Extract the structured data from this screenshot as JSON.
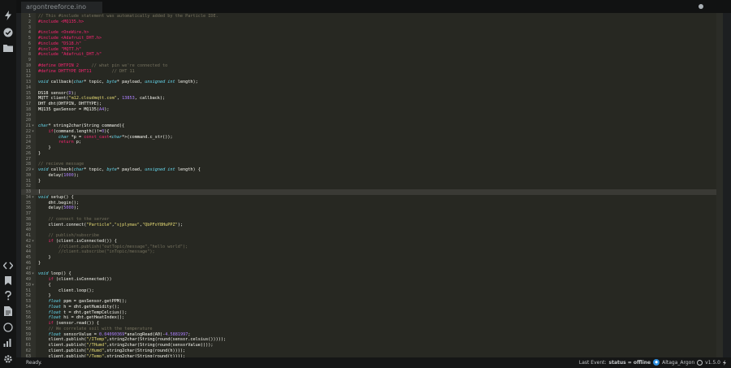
{
  "tab": {
    "filename": "argontreeforce.ino"
  },
  "status": {
    "ready": "Ready.",
    "last_event_label": "Last Event:",
    "last_event_value": "status = offline",
    "device_name": "Altaga_Argon",
    "version": "v1.5.0"
  },
  "sidebar_icons": [
    "flash-icon",
    "verify-icon",
    "folder-icon",
    "code-icon",
    "bookmark-icon",
    "help-icon",
    "document-icon",
    "target-icon",
    "chart-icon",
    "gear-icon"
  ],
  "code_lines": [
    {
      "n": 1,
      "segs": [
        [
          "cm",
          "// This #include statement was automatically added by the Particle IDE."
        ]
      ]
    },
    {
      "n": 2,
      "segs": [
        [
          "pp",
          "#include <MQ135.h>"
        ]
      ]
    },
    {
      "n": 3,
      "segs": []
    },
    {
      "n": 4,
      "segs": [
        [
          "pp",
          "#include <OneWire.h>"
        ]
      ]
    },
    {
      "n": 5,
      "segs": [
        [
          "pp",
          "#include <Adafruit_DHT.h>"
        ]
      ]
    },
    {
      "n": 6,
      "segs": [
        [
          "pp",
          "#include \"DS18.h\""
        ]
      ]
    },
    {
      "n": 7,
      "segs": [
        [
          "pp",
          "#include \"MQTT.h\""
        ]
      ]
    },
    {
      "n": 8,
      "segs": [
        [
          "pp",
          "#include \"Adafruit_DHT.h\""
        ]
      ]
    },
    {
      "n": 9,
      "segs": []
    },
    {
      "n": 10,
      "segs": [
        [
          "pp",
          "#define DHTPIN 2"
        ],
        [
          "cm",
          "     // what pin we're connected to"
        ]
      ]
    },
    {
      "n": 11,
      "segs": [
        [
          "pp",
          "#define DHTTYPE DHT11"
        ],
        [
          "cm",
          "        // DHT 11"
        ]
      ]
    },
    {
      "n": 12,
      "segs": []
    },
    {
      "n": 13,
      "segs": [
        [
          "kw",
          "void"
        ],
        [
          "tx",
          " callback("
        ],
        [
          "kw",
          "char"
        ],
        [
          "tx",
          "* topic, "
        ],
        [
          "kw",
          "byte"
        ],
        [
          "tx",
          "* payload, "
        ],
        [
          "kw",
          "unsigned int"
        ],
        [
          "tx",
          " length);"
        ]
      ]
    },
    {
      "n": 14,
      "segs": []
    },
    {
      "n": 15,
      "segs": [
        [
          "tx",
          "DS18 sensor("
        ],
        [
          "nu",
          "D"
        ],
        [
          "tx",
          ");"
        ]
      ]
    },
    {
      "n": 16,
      "segs": [
        [
          "tx",
          "MQTT client("
        ],
        [
          "st",
          "\"m12.cloudmqtt.com\""
        ],
        [
          "tx",
          ", "
        ],
        [
          "nu",
          "13853"
        ],
        [
          "tx",
          ", callback);"
        ]
      ]
    },
    {
      "n": 17,
      "segs": [
        [
          "tx",
          "DHT dht(DHTPIN, DHTTYPE);"
        ]
      ]
    },
    {
      "n": 18,
      "segs": [
        [
          "tx",
          "MQ135 gasSensor = MQ135("
        ],
        [
          "nu",
          "A4"
        ],
        [
          "tx",
          ");"
        ]
      ]
    },
    {
      "n": 19,
      "segs": []
    },
    {
      "n": 20,
      "segs": []
    },
    {
      "n": 21,
      "fold": true,
      "segs": [
        [
          "kw",
          "char"
        ],
        [
          "tx",
          "* string2char(String command){"
        ]
      ]
    },
    {
      "n": 22,
      "fold": true,
      "segs": [
        [
          "tx",
          "    "
        ],
        [
          "ret",
          "if"
        ],
        [
          "tx",
          "(command.length()!="
        ],
        [
          "nu",
          "0"
        ],
        [
          "tx",
          "){"
        ]
      ]
    },
    {
      "n": 23,
      "segs": [
        [
          "tx",
          "        "
        ],
        [
          "kw",
          "char"
        ],
        [
          "tx",
          " *p = "
        ],
        [
          "ret",
          "const_cast"
        ],
        [
          "tx",
          "<"
        ],
        [
          "kw",
          "char"
        ],
        [
          "tx",
          "*>(command.c_str());"
        ]
      ]
    },
    {
      "n": 24,
      "segs": [
        [
          "tx",
          "        "
        ],
        [
          "ret",
          "return"
        ],
        [
          "tx",
          " p;"
        ]
      ]
    },
    {
      "n": 25,
      "segs": [
        [
          "tx",
          "    }"
        ]
      ]
    },
    {
      "n": 26,
      "segs": [
        [
          "tx",
          "}"
        ]
      ]
    },
    {
      "n": 27,
      "segs": []
    },
    {
      "n": 28,
      "segs": [
        [
          "cm",
          "// recieve message"
        ]
      ]
    },
    {
      "n": 29,
      "fold": true,
      "segs": [
        [
          "kw",
          "void"
        ],
        [
          "tx",
          " callback("
        ],
        [
          "kw",
          "char"
        ],
        [
          "tx",
          "* topic, "
        ],
        [
          "kw",
          "byte"
        ],
        [
          "tx",
          "* payload, "
        ],
        [
          "kw",
          "unsigned int"
        ],
        [
          "tx",
          " length) {"
        ]
      ]
    },
    {
      "n": 30,
      "segs": [
        [
          "tx",
          "    delay("
        ],
        [
          "nu",
          "1000"
        ],
        [
          "tx",
          ");"
        ]
      ]
    },
    {
      "n": 31,
      "segs": [
        [
          "tx",
          "}"
        ]
      ]
    },
    {
      "n": 32,
      "segs": []
    },
    {
      "n": 33,
      "active": true,
      "segs": [
        [
          "cur",
          "|"
        ]
      ]
    },
    {
      "n": 34,
      "fold": true,
      "segs": [
        [
          "kw",
          "void"
        ],
        [
          "tx",
          " setup() {"
        ]
      ]
    },
    {
      "n": 35,
      "segs": [
        [
          "tx",
          "    dht.begin();"
        ]
      ]
    },
    {
      "n": 36,
      "segs": [
        [
          "tx",
          "    delay("
        ],
        [
          "nu",
          "5000"
        ],
        [
          "tx",
          ");"
        ]
      ]
    },
    {
      "n": 37,
      "segs": []
    },
    {
      "n": 38,
      "segs": [
        [
          "tx",
          "    "
        ],
        [
          "cm",
          "// connect to the server"
        ]
      ]
    },
    {
      "n": 39,
      "segs": [
        [
          "tx",
          "    client.connect("
        ],
        [
          "st",
          "\"Particle\""
        ],
        [
          "tx",
          ","
        ],
        [
          "st",
          "\"sjplymav\""
        ],
        [
          "tx",
          ","
        ],
        [
          "st",
          "\"QbPFoY8HuPPZ\""
        ],
        [
          "tx",
          ");"
        ]
      ]
    },
    {
      "n": 40,
      "segs": []
    },
    {
      "n": 41,
      "segs": [
        [
          "tx",
          "    "
        ],
        [
          "cm",
          "// publish/subscribe"
        ]
      ]
    },
    {
      "n": 42,
      "fold": true,
      "segs": [
        [
          "tx",
          "    "
        ],
        [
          "ret",
          "if"
        ],
        [
          "tx",
          " (client.isConnected()) {"
        ]
      ]
    },
    {
      "n": 43,
      "segs": [
        [
          "tx",
          "        "
        ],
        [
          "cm",
          "//client.publish(\"outTopic/message\",\"hello world\");"
        ]
      ]
    },
    {
      "n": 44,
      "segs": [
        [
          "tx",
          "        "
        ],
        [
          "cm",
          "//client.subscribe(\"inTopic/message\");"
        ]
      ]
    },
    {
      "n": 45,
      "segs": [
        [
          "tx",
          "    }"
        ]
      ]
    },
    {
      "n": 46,
      "segs": [
        [
          "tx",
          "}"
        ]
      ]
    },
    {
      "n": 47,
      "segs": []
    },
    {
      "n": 48,
      "fold": true,
      "segs": [
        [
          "kw",
          "void"
        ],
        [
          "tx",
          " loop() {"
        ]
      ]
    },
    {
      "n": 49,
      "segs": [
        [
          "tx",
          "    "
        ],
        [
          "ret",
          "if"
        ],
        [
          "tx",
          " (client.isConnected())"
        ]
      ]
    },
    {
      "n": 50,
      "fold": true,
      "segs": [
        [
          "tx",
          "    {"
        ]
      ]
    },
    {
      "n": 51,
      "segs": [
        [
          "tx",
          "        client.loop();"
        ]
      ]
    },
    {
      "n": 52,
      "segs": [
        [
          "tx",
          "    }"
        ]
      ]
    },
    {
      "n": 53,
      "segs": [
        [
          "tx",
          "    "
        ],
        [
          "kw",
          "float"
        ],
        [
          "tx",
          " ppm = gasSensor.getPPM();"
        ]
      ]
    },
    {
      "n": 54,
      "segs": [
        [
          "tx",
          "    "
        ],
        [
          "kw",
          "float"
        ],
        [
          "tx",
          " h = dht.getHumidity();"
        ]
      ]
    },
    {
      "n": 55,
      "segs": [
        [
          "tx",
          "    "
        ],
        [
          "kw",
          "float"
        ],
        [
          "tx",
          " t = dht.getTempCelcius();"
        ]
      ]
    },
    {
      "n": 56,
      "segs": [
        [
          "tx",
          "    "
        ],
        [
          "kw",
          "float"
        ],
        [
          "tx",
          " hi = dht.getHeatIndex();"
        ]
      ]
    },
    {
      "n": 57,
      "segs": [
        [
          "tx",
          "    "
        ],
        [
          "ret",
          "if"
        ],
        [
          "tx",
          " (sensor.read()) {"
        ]
      ]
    },
    {
      "n": 58,
      "segs": [
        [
          "tx",
          "    "
        ],
        [
          "cm",
          "// We correlate soil with the temperature"
        ]
      ]
    },
    {
      "n": 59,
      "segs": [
        [
          "tx",
          "    "
        ],
        [
          "kw",
          "float"
        ],
        [
          "tx",
          " sensorValue = "
        ],
        [
          "nu",
          "0.04090369"
        ],
        [
          "tx",
          "*analogRead(A0)-"
        ],
        [
          "nu",
          "4.5881997"
        ],
        [
          "tx",
          ";"
        ]
      ]
    },
    {
      "n": 60,
      "segs": [
        [
          "tx",
          "    client.publish("
        ],
        [
          "st",
          "\"/ITemp\""
        ],
        [
          "tx",
          ",string2char(String(round(sensor.celsius()))));"
        ]
      ]
    },
    {
      "n": 61,
      "segs": [
        [
          "tx",
          "    client.publish("
        ],
        [
          "st",
          "\"/THumd\""
        ],
        [
          "tx",
          ",string2char(String(round(sensorValue))));"
        ]
      ]
    },
    {
      "n": 62,
      "segs": [
        [
          "tx",
          "    client.publish("
        ],
        [
          "st",
          "\"/Humd\""
        ],
        [
          "tx",
          ",string2char(String(round(h))));"
        ]
      ]
    },
    {
      "n": 63,
      "segs": [
        [
          "tx",
          "    client.publish("
        ],
        [
          "st",
          "\"/Temp\""
        ],
        [
          "tx",
          ",string2char(String(round(t))));"
        ]
      ]
    }
  ]
}
